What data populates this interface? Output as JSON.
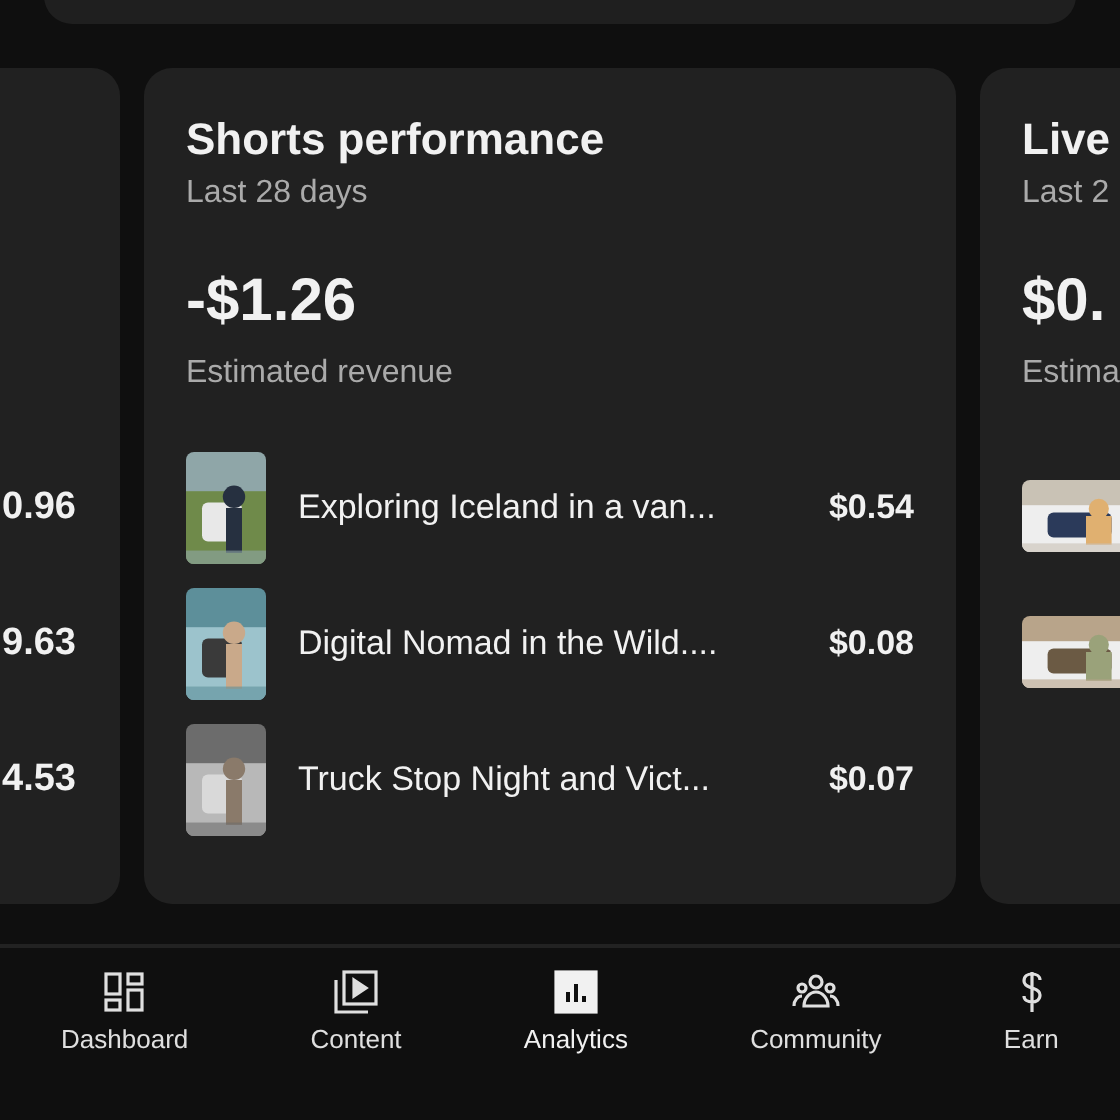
{
  "left_card": {
    "amounts": [
      "0.96",
      "9.63",
      "4.53"
    ]
  },
  "shorts_card": {
    "title": "Shorts performance",
    "period": "Last 28 days",
    "total": "-$1.26",
    "total_label": "Estimated revenue",
    "videos": [
      {
        "title": "Exploring Iceland in a van...",
        "amount": "$0.54",
        "kind": "picture"
      },
      {
        "title": "Digital Nomad in the Wild....",
        "amount": "$0.08",
        "kind": "picture"
      },
      {
        "title": "Truck Stop Night and Vict...",
        "amount": "$0.07",
        "kind": "picture"
      }
    ]
  },
  "live_card": {
    "title": "Live",
    "period": "Last 2",
    "total": "$0.",
    "total_label": "Estima"
  },
  "nav": [
    {
      "label": "Dashboard",
      "selected": false
    },
    {
      "label": "Content",
      "selected": false
    },
    {
      "label": "Analytics",
      "selected": true
    },
    {
      "label": "Community",
      "selected": false
    },
    {
      "label": "Earn",
      "selected": false
    }
  ]
}
